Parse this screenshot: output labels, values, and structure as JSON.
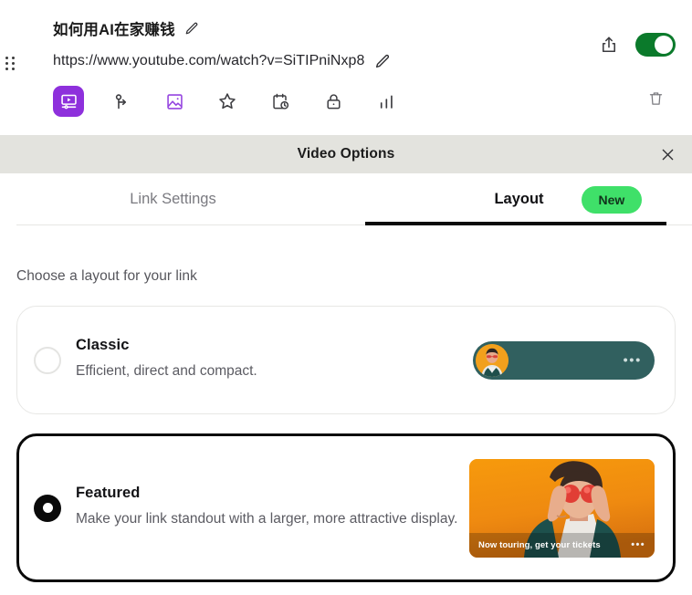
{
  "link": {
    "title": "如何用AI在家赚钱",
    "url": "https://www.youtube.com/watch?v=SiTIPniNxp8",
    "edit_title_icon": "pencil-icon",
    "edit_url_icon": "pencil-icon",
    "drag_handle_icon": "drag-handle-icon",
    "share_icon": "share-icon",
    "delete_icon": "trash-icon",
    "toggle_state": "on",
    "toggle_color": "#0b7a2b",
    "active_icon_color": "#8e30dc",
    "tools": [
      {
        "name": "video-player-icon",
        "label": "Video",
        "active": true
      },
      {
        "name": "redirect-branch-icon",
        "label": "Redirect",
        "active": false
      },
      {
        "name": "image-icon",
        "label": "Thumbnail",
        "active": false
      },
      {
        "name": "star-icon",
        "label": "Favorite",
        "active": false
      },
      {
        "name": "schedule-clock-icon",
        "label": "Schedule",
        "active": false
      },
      {
        "name": "lock-icon",
        "label": "Lock",
        "active": false
      },
      {
        "name": "bar-chart-icon",
        "label": "Analytics",
        "active": false
      }
    ]
  },
  "modal": {
    "title": "Video Options",
    "close_icon": "close-icon",
    "header_bg": "#e3e3de",
    "tabs": [
      {
        "label": "Link Settings",
        "active": false
      },
      {
        "label": "Layout",
        "active": true
      }
    ],
    "badge": {
      "label": "New",
      "color": "#3fe069"
    }
  },
  "layout": {
    "section_label": "Choose a layout for your link",
    "options": [
      {
        "title": "Classic",
        "description": "Efficient, direct and compact.",
        "selected": false,
        "preview": {
          "type": "pill",
          "bg_color": "#31605f",
          "avatar_bg": "#f2a01c",
          "menu_icon": "ellipsis-icon"
        }
      },
      {
        "title": "Featured",
        "description": "Make your link standout with a larger, more attractive display.",
        "selected": true,
        "preview": {
          "type": "card",
          "bg_color": "#f08c10",
          "caption": "Now touring, get your tickets",
          "menu_icon": "ellipsis-icon"
        }
      }
    ]
  }
}
